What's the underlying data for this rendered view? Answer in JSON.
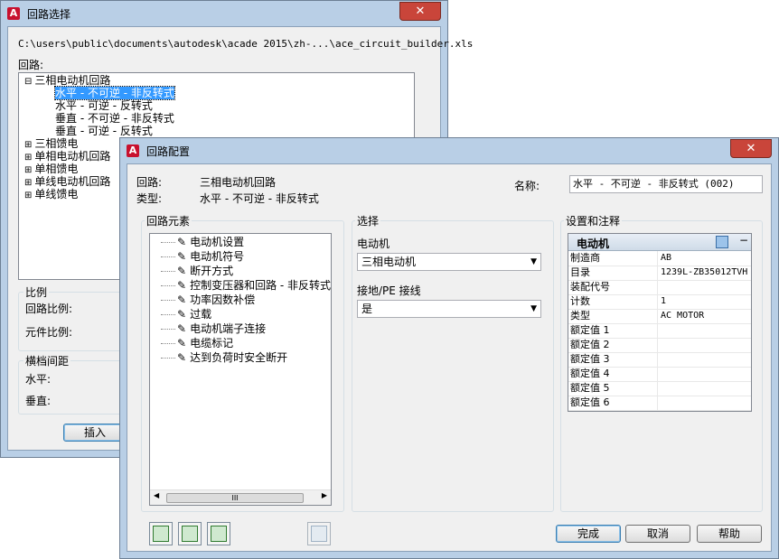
{
  "back_dialog": {
    "title": "回路选择",
    "path": "C:\\users\\public\\documents\\autodesk\\acade 2015\\zh-...\\ace_circuit_builder.xls",
    "circuits_label": "回路:",
    "tree": [
      {
        "label": "三相电动机回路",
        "prefix": "⊟",
        "indent": 0
      },
      {
        "label": "水平 - 不可逆 - 非反转式",
        "indent": 2,
        "selected": true
      },
      {
        "label": "水平 - 可逆 - 反转式",
        "indent": 2
      },
      {
        "label": "垂直 - 不可逆 - 非反转式",
        "indent": 2
      },
      {
        "label": "垂直 - 可逆 - 反转式",
        "indent": 2
      },
      {
        "label": "三相馈电",
        "prefix": "⊞",
        "indent": 0
      },
      {
        "label": "单相电动机回路",
        "prefix": "⊞",
        "indent": 0
      },
      {
        "label": "单相馈电",
        "prefix": "⊞",
        "indent": 0
      },
      {
        "label": "单线电动机回路",
        "prefix": "⊞",
        "indent": 0
      },
      {
        "label": "单线馈电",
        "prefix": "⊞",
        "indent": 0
      }
    ],
    "scale_group": "比例",
    "circuit_scale": "回路比例:",
    "component_scale": "元件比例:",
    "rung_group": "横档间距",
    "horizontal": "水平:",
    "vertical": "垂直:",
    "insert_button": "插入"
  },
  "front_dialog": {
    "title": "回路配置",
    "circuit_label": "回路:",
    "circuit_value": "三相电动机回路",
    "type_label": "类型:",
    "type_value": "水平 - 不可逆 - 非反转式",
    "name_label": "名称:",
    "name_value": "水平 - 不可逆 - 非反转式 (002)",
    "elements_group": "回路元素",
    "elements": [
      "电动机设置",
      "电动机符号",
      "断开方式",
      "控制变压器和回路 - 非反转式",
      "功率因数补偿",
      "过载",
      "电动机端子连接",
      "电缆标记",
      "达到负荷时安全断开"
    ],
    "scroll_mark": "III",
    "select_group": "选择",
    "motor_label": "电动机",
    "motor_value": "三相电动机",
    "ground_label": "接地/PE 接线",
    "ground_value": "是",
    "settings_group": "设置和注释",
    "prop_header": "电动机",
    "props": [
      {
        "k": "制造商",
        "v": "AB"
      },
      {
        "k": "目录",
        "v": "1239L-ZB35012TVH"
      },
      {
        "k": "装配代号",
        "v": ""
      },
      {
        "k": "计数",
        "v": "1"
      },
      {
        "k": "类型",
        "v": "AC MOTOR"
      },
      {
        "k": "额定值 1",
        "v": ""
      },
      {
        "k": "额定值 2",
        "v": ""
      },
      {
        "k": "额定值 3",
        "v": ""
      },
      {
        "k": "额定值 4",
        "v": ""
      },
      {
        "k": "额定值 5",
        "v": ""
      },
      {
        "k": "额定值 6",
        "v": ""
      }
    ],
    "done_button": "完成",
    "cancel_button": "取消",
    "help_button": "帮助"
  }
}
